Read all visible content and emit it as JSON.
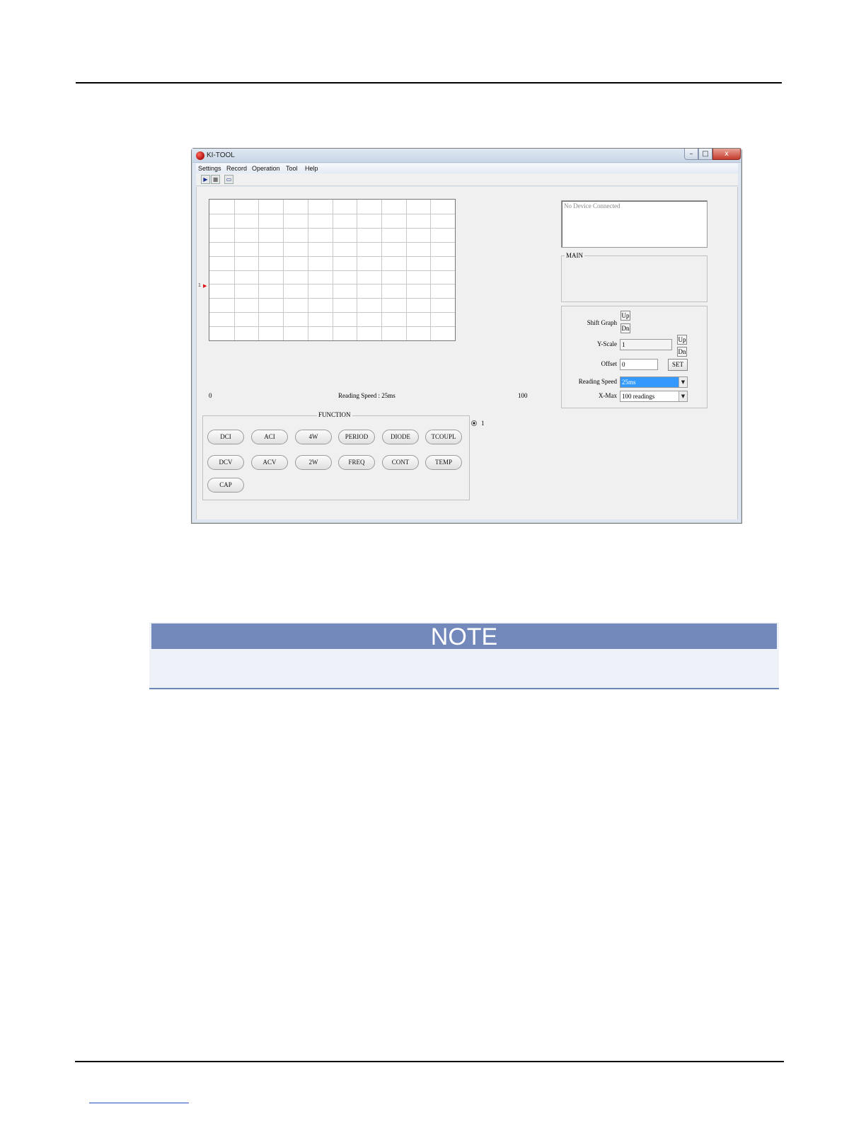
{
  "window": {
    "title": "KI-TOOL",
    "controls": {
      "minimize": "–",
      "maximize": "□",
      "close": "x"
    }
  },
  "menu": [
    "Settings",
    "Record",
    "Operation",
    "Tool",
    "Help"
  ],
  "toolbar": {
    "run_icon": "▶",
    "stop_icon": "■",
    "connect_icon": "▭"
  },
  "graph": {
    "columns": 10,
    "rows": 10,
    "trace_label": "1",
    "trace_marker": "▶",
    "x_min_label": "0",
    "x_max_label": "100",
    "reading_speed_label": "Reading Speed : 25ms"
  },
  "function_group": {
    "title": "FUNCTION",
    "buttons_row1": [
      "DCI",
      "ACI",
      "4W",
      "PERIOD",
      "DIODE",
      "TCOUPL"
    ],
    "buttons_row2": [
      "DCV",
      "ACV",
      "2W",
      "FREQ",
      "CONT",
      "TEMP"
    ],
    "buttons_row3": [
      "CAP"
    ]
  },
  "channel_radio": {
    "label": "1"
  },
  "status": {
    "text": "No Device Connected"
  },
  "main_group": {
    "title": "MAIN"
  },
  "controls": {
    "shift_graph": {
      "label": "Shift Graph",
      "up": "Up",
      "down": "Dn"
    },
    "y_scale": {
      "label": "Y-Scale",
      "value": "1",
      "up": "Up",
      "down": "Dn"
    },
    "offset": {
      "label": "Offset",
      "value": "0",
      "set": "SET"
    },
    "reading_speed": {
      "label": "Reading Speed",
      "value": "25ms"
    },
    "x_max": {
      "label": "X-Max",
      "value": "100 readings"
    },
    "dropdown_arrow": "▼"
  },
  "note": {
    "title": "NOTE"
  },
  "colors": {
    "note_header": "#7389bb",
    "note_body": "#eef1f7",
    "selection": "#3399ff",
    "trace_marker": "#dd1111"
  }
}
